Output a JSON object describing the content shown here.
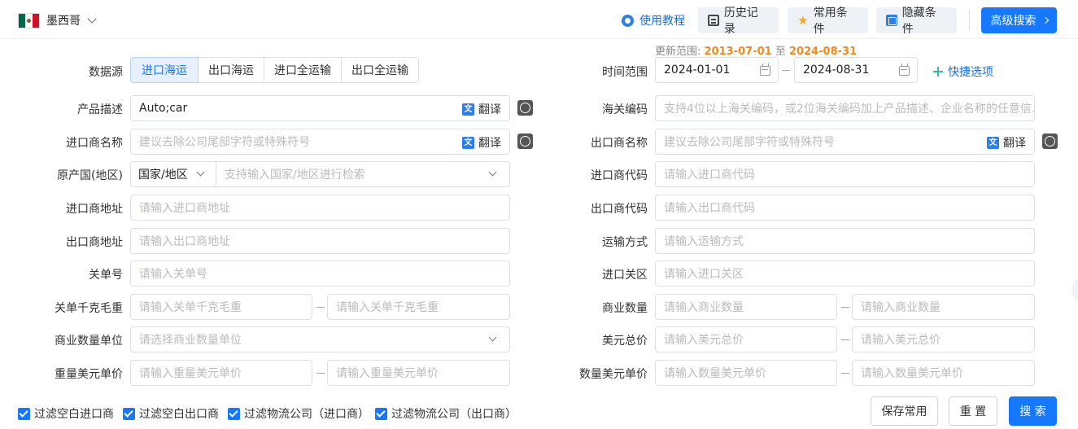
{
  "header": {
    "country": "墨西哥",
    "tutorial": "使用教程",
    "history": "历史记录",
    "saved": "常用条件",
    "hidden": "隐藏条件",
    "advanced": "高级搜索"
  },
  "update_range": {
    "label": "更新范围:",
    "start": "2013-07-01",
    "sep": "至",
    "end": "2024-08-31"
  },
  "datasource": {
    "label": "数据源",
    "options": [
      "进口海运",
      "出口海运",
      "进口全运输",
      "出口全运输"
    ],
    "active": "进口海运"
  },
  "time_range": {
    "label": "时间范围",
    "start": "2024-01-01",
    "end": "2024-08-31",
    "quick": "快捷选项"
  },
  "translate_label": "翻译",
  "fields": {
    "product_desc": {
      "label": "产品描述",
      "value": "Auto;car"
    },
    "hs_code": {
      "label": "海关编码",
      "placeholder": "支持4位以上海关编码，或2位海关编码加上产品描述、企业名称的任意信..."
    },
    "importer_name": {
      "label": "进口商名称",
      "placeholder": "建议去除公司尾部字符或特殊符号"
    },
    "exporter_name": {
      "label": "出口商名称",
      "placeholder": "建议去除公司尾部字符或特殊符号"
    },
    "origin": {
      "label": "原产国(地区)",
      "select": "国家/地区",
      "placeholder": "支持输入国家/地区进行检索"
    },
    "importer_code": {
      "label": "进口商代码",
      "placeholder": "请输入进口商代码"
    },
    "importer_addr": {
      "label": "进口商地址",
      "placeholder": "请输入进口商地址"
    },
    "exporter_code": {
      "label": "出口商代码",
      "placeholder": "请输入出口商代码"
    },
    "exporter_addr": {
      "label": "出口商地址",
      "placeholder": "请输入出口商地址"
    },
    "transport": {
      "label": "运输方式",
      "placeholder": "请输入运输方式"
    },
    "bill_no": {
      "label": "关单号",
      "placeholder": "请输入关单号"
    },
    "customs": {
      "label": "进口关区",
      "placeholder": "请输入进口关区"
    },
    "gross_weight": {
      "label": "关单千克毛重",
      "ph_min": "请输入关单千克毛重",
      "ph_max": "请输入关单千克毛重"
    },
    "commercial_qty": {
      "label": "商业数量",
      "ph_min": "请输入商业数量",
      "ph_max": "请输入商业数量"
    },
    "qty_unit": {
      "label": "商业数量单位",
      "placeholder": "请选择商业数量单位"
    },
    "usd_total": {
      "label": "美元总价",
      "ph_min": "请输入美元总价",
      "ph_max": "请输入美元总价"
    },
    "weight_usd_price": {
      "label": "重量美元单价",
      "ph_min": "请输入重量美元单价",
      "ph_max": "请输入重量美元单价"
    },
    "qty_usd_price": {
      "label": "数量美元单价",
      "ph_min": "请输入数量美元单价",
      "ph_max": "请输入数量美元单价"
    }
  },
  "filters": [
    "过滤空白进口商",
    "过滤空白出口商",
    "过滤物流公司（进口商）",
    "过滤物流公司（出口商）"
  ],
  "buttons": {
    "save": "保存常用",
    "reset": "重 置",
    "search": "搜 索"
  },
  "colors": {
    "primary": "#1677ff",
    "accent_date": "#f08a1c"
  }
}
